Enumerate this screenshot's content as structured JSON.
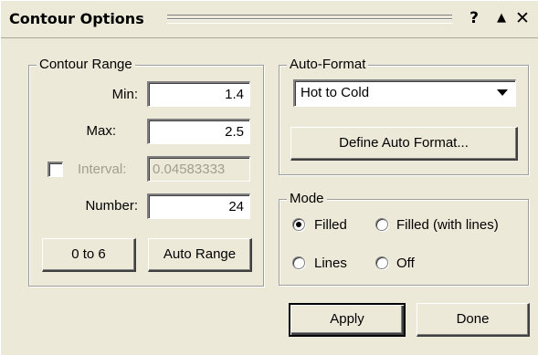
{
  "window": {
    "title": "Contour Options",
    "help_glyph": "?",
    "rollup_glyph": "▲",
    "close_glyph": "✕"
  },
  "contour_range": {
    "legend": "Contour Range",
    "min_label": "Min:",
    "min_value": "1.4",
    "max_label": "Max:",
    "max_value": "2.5",
    "interval_label": "Interval:",
    "interval_value": "0.04583333",
    "interval_checked": false,
    "number_label": "Number:",
    "number_value": "24",
    "zero_to_six_label": "0 to 6",
    "auto_range_label": "Auto Range"
  },
  "auto_format": {
    "legend": "Auto-Format",
    "selected": "Hot to Cold",
    "define_label": "Define Auto Format..."
  },
  "mode": {
    "legend": "Mode",
    "options": [
      {
        "label": "Filled",
        "checked": true
      },
      {
        "label": "Filled (with lines)",
        "checked": false
      },
      {
        "label": "Lines",
        "checked": false
      },
      {
        "label": "Off",
        "checked": false
      }
    ]
  },
  "footer": {
    "apply_label": "Apply",
    "done_label": "Done"
  }
}
